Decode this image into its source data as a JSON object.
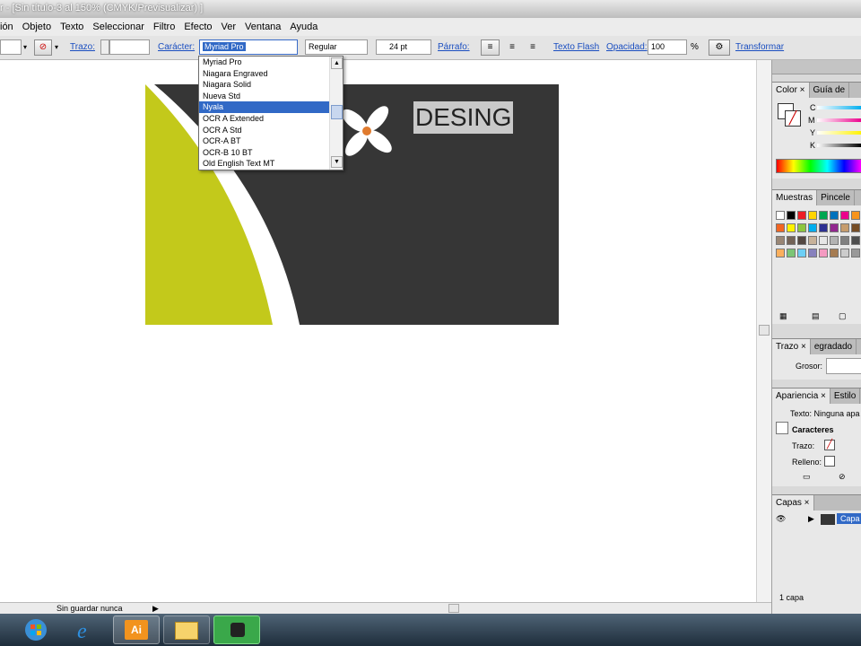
{
  "window": {
    "title": "r - [Sin título-3 al 150% (CMYK/Previsualizar) ]"
  },
  "menu": [
    "ión",
    "Objeto",
    "Texto",
    "Seleccionar",
    "Filtro",
    "Efecto",
    "Ver",
    "Ventana",
    "Ayuda"
  ],
  "control": {
    "trazo_label": "Trazo:",
    "caracter_label": "Carácter:",
    "font_value": "Myriad Pro",
    "style_value": "Regular",
    "size_value": "24 pt",
    "parrafo_label": "Párrafo:",
    "texto_flash": "Texto Flash",
    "opacidad_label": "Opacidad:",
    "opacidad_value": "100",
    "percent": "%",
    "transformar": "Transformar"
  },
  "font_dropdown": {
    "options": [
      "Myriad Pro",
      "Niagara Engraved",
      "Niagara Solid",
      "Nueva Std",
      "Nyala",
      "OCR A Extended",
      "OCR A Std",
      "OCR-A BT",
      "OCR-B 10 BT",
      "Old English Text MT"
    ],
    "selected": "Nyala"
  },
  "artwork": {
    "text": "DESING",
    "colors": {
      "bg": "#363636",
      "lime": "#c3c91b",
      "flower": "#ffffff",
      "center": "#e07b2e"
    }
  },
  "panels": {
    "color_tabs": [
      "Color",
      "Guía de"
    ],
    "cmyk_labels": [
      "C",
      "M",
      "Y",
      "K"
    ],
    "swatch_tabs": [
      "Muestras",
      "Pincele"
    ],
    "trazo_tabs": [
      "Trazo",
      "egradado"
    ],
    "grosor_label": "Grosor:",
    "apariencia_tabs": [
      "Apariencia",
      "Estilo"
    ],
    "apariencia_text": "Texto: Ninguna apa",
    "caracteres": "Caracteres",
    "trazo_row": "Trazo:",
    "relleno_row": "Relleno:",
    "capas_tab": "Capas",
    "capa_name": "Capa",
    "capas_count": "1 capa"
  },
  "status": {
    "text": "Sin guardar nunca"
  },
  "taskbar": {
    "ai_label": "Ai"
  }
}
